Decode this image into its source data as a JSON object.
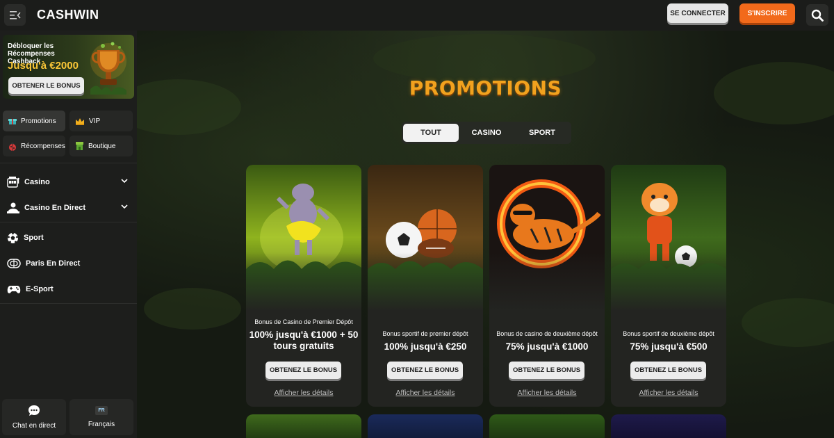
{
  "header": {
    "logo": "CASHWIN",
    "login_label": "SE CONNECTER",
    "signup_label": "S'INSCRIRE",
    "icons": [
      "menu-collapse-icon",
      "search-icon"
    ]
  },
  "sidebar": {
    "banner": {
      "line1": "Débloquer les Récompenses Cashback",
      "line2": "Jusqu'à €2000",
      "button": "OBTENER LE BONUS"
    },
    "chips": [
      {
        "label": "Promotions",
        "icon": "gift-icon"
      },
      {
        "label": "VIP",
        "icon": "crown-icon"
      },
      {
        "label": "Récompenses",
        "icon": "ladybug-icon"
      },
      {
        "label": "Boutique",
        "icon": "shop-icon"
      }
    ],
    "nav": [
      {
        "label": "Casino",
        "icon": "slot-machine-icon"
      },
      {
        "label": "Casino En Direct",
        "icon": "live-dealer-icon"
      },
      {
        "label": "Sport",
        "icon": "soccer-ball-icon"
      },
      {
        "label": "Paris En Direct",
        "icon": "live-betting-icon"
      },
      {
        "label": "E-Sport",
        "icon": "gamepad-icon"
      }
    ],
    "chat_label": "Chat en direct",
    "language_badge": "FR",
    "language_label": "Français"
  },
  "main": {
    "title": "PROMOTIONS",
    "tabs": [
      "TOUT",
      "CASINO",
      "SPORT"
    ],
    "active_tab": "TOUT",
    "cards": [
      {
        "subtitle": "Bonus de Casino de Premier Dépôt",
        "headline": "100% jusqu'à €1000 + 50 tours gratuits",
        "button": "OBTENEZ LE BONUS",
        "link": "Afficher les détails"
      },
      {
        "subtitle": "Bonus sportif de premier dépôt",
        "headline": "100% jusqu'à €250",
        "button": "OBTENEZ LE BONUS",
        "link": "Afficher les détails"
      },
      {
        "subtitle": "Bonus de casino de deuxième dépôt",
        "headline": "75% jusqu'à €1000",
        "button": "OBTENEZ LE BONUS",
        "link": "Afficher les détails"
      },
      {
        "subtitle": "Bonus sportif de deuxième dépôt",
        "headline": "75% jusqu'à €500",
        "button": "OBTENEZ LE BONUS",
        "link": "Afficher les détails"
      }
    ]
  },
  "colors": {
    "accent_orange": "#f26a1b",
    "title_gold": "#f2a21e",
    "banner_yellow": "#f8c537"
  }
}
